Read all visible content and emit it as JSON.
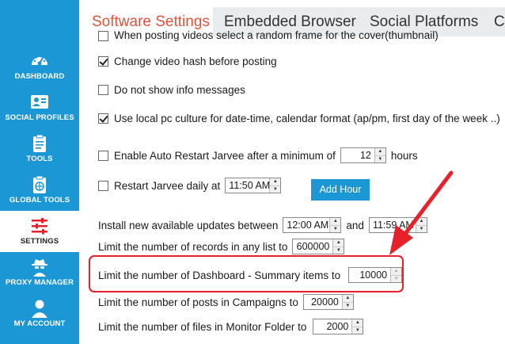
{
  "sidebar": {
    "items": [
      {
        "label": "DASHBOARD",
        "icon": "speedometer-icon"
      },
      {
        "label": "SOCIAL PROFILES",
        "icon": "profile-card-icon"
      },
      {
        "label": "TOOLS",
        "icon": "clipboard-icon"
      },
      {
        "label": "GLOBAL TOOLS",
        "icon": "globe-clipboard-icon"
      },
      {
        "label": "SETTINGS",
        "icon": "sliders-icon",
        "active": true
      },
      {
        "label": "PROXY MANAGER",
        "icon": "spy-icon"
      },
      {
        "label": "MY ACCOUNT",
        "icon": "user-icon"
      }
    ]
  },
  "tabs": [
    {
      "label": "Software Settings",
      "active": true
    },
    {
      "label": "Embedded Browser"
    },
    {
      "label": "Social Platforms"
    },
    {
      "label": "Co"
    }
  ],
  "settings": {
    "random_frame": "When posting videos select a random frame for the cover(thumbnail)",
    "change_hash": "Change video hash before posting",
    "no_info": "Do not show info messages",
    "local_culture": "Use local pc culture for date-time, calendar format (ap/pm, first day of the week ..)",
    "auto_restart_label": "Enable Auto Restart Jarvee after a minimum of",
    "auto_restart_value": "12",
    "auto_restart_unit": "hours",
    "restart_daily_label": "Restart Jarvee daily at",
    "restart_daily_value": "11:50 AM",
    "add_hour_button": "Add Hour",
    "updates_label": "Install new available updates between",
    "updates_from": "12:00 AM",
    "updates_and": "and",
    "updates_to": "11:59 AM",
    "records_label": "Limit the number of records in any list to",
    "records_value": "600000",
    "dashboard_label": "Limit the number of Dashboard - Summary items to",
    "dashboard_value": "10000",
    "campaign_label": "Limit the number of posts in Campaigns to",
    "campaign_value": "20000",
    "monitor_label": "Limit the number of files in Monitor Folder to",
    "monitor_value": "2000"
  },
  "colors": {
    "accent": "#1b97d5",
    "highlight": "#e8202a",
    "active_tab": "#e0523c"
  }
}
